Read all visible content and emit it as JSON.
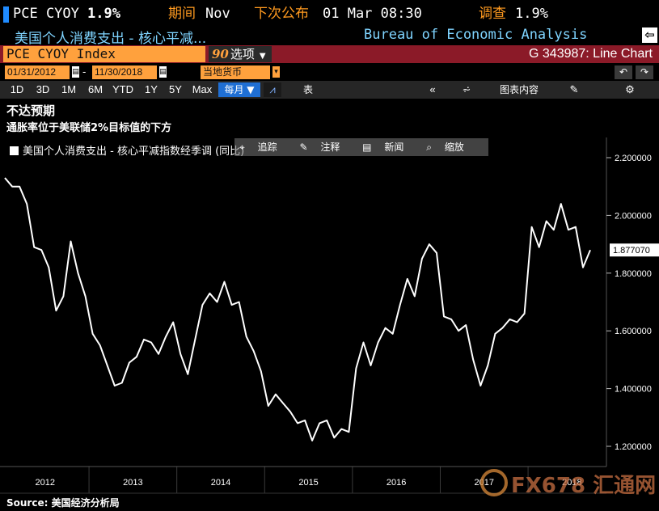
{
  "header": {
    "symbol": "PCE CYOY",
    "last_value": "1.9%",
    "period_label": "期间",
    "period_value": "Nov",
    "next_release_label": "下次公布",
    "next_release_value": "01 Mar 08:30",
    "survey_label": "调查",
    "survey_value": "1.9%",
    "description": "美国个人消费支出 - 核心平减...",
    "source": "Bureau of Economic Analysis",
    "export_icon": "export-arrow-icon"
  },
  "command_bar": {
    "ticker": "PCE CYOY Index",
    "options_number": "90",
    "options_label": "选项",
    "chart_id": "G 343987: Line Chart"
  },
  "date_bar": {
    "start_date": "01/31/2012",
    "end_date": "11/30/2018",
    "currency": "当地货币"
  },
  "range_bar": {
    "ranges": [
      "1D",
      "3D",
      "1M",
      "6M",
      "YTD",
      "1Y",
      "5Y",
      "Max"
    ],
    "frequency": "每月",
    "table_label": "表",
    "edit_label": "图表内容"
  },
  "legend_tools": {
    "track": "追踪",
    "annotate": "注释",
    "news": "新闻",
    "zoom": "缩放"
  },
  "chart_data": {
    "type": "line",
    "title": "不达预期",
    "subtitle": "通胀率位于美联储2%目标值的下方",
    "source": "Source:  美国经济分析局",
    "y_ticks": [
      "1.200000",
      "1.400000",
      "1.600000",
      "1.800000",
      "2.000000",
      "2.200000"
    ],
    "y_tick_values": [
      1.2,
      1.4,
      1.6,
      1.8,
      2.0,
      2.2
    ],
    "ylim": [
      1.13,
      2.27
    ],
    "x_ticks": [
      "2012",
      "2013",
      "2014",
      "2015",
      "2016",
      "2017",
      "2018"
    ],
    "last_value_label": "1.877070",
    "colors": {
      "line": "#ffffff",
      "background": "#000000",
      "grid": "#555555"
    },
    "series": [
      {
        "name": "美国个人消费支出 - 核心平减指数经季调 (同比)",
        "start": "2012-01",
        "values": [
          2.13,
          2.1,
          2.1,
          2.04,
          1.89,
          1.88,
          1.82,
          1.67,
          1.72,
          1.91,
          1.8,
          1.72,
          1.59,
          1.55,
          1.48,
          1.41,
          1.42,
          1.49,
          1.51,
          1.57,
          1.56,
          1.52,
          1.58,
          1.63,
          1.52,
          1.45,
          1.57,
          1.69,
          1.73,
          1.7,
          1.77,
          1.69,
          1.7,
          1.58,
          1.53,
          1.46,
          1.34,
          1.38,
          1.35,
          1.32,
          1.28,
          1.29,
          1.22,
          1.28,
          1.29,
          1.23,
          1.26,
          1.25,
          1.47,
          1.56,
          1.48,
          1.56,
          1.61,
          1.59,
          1.69,
          1.78,
          1.72,
          1.85,
          1.9,
          1.87,
          1.65,
          1.64,
          1.6,
          1.62,
          1.5,
          1.41,
          1.48,
          1.59,
          1.61,
          1.64,
          1.63,
          1.66,
          1.96,
          1.89,
          1.98,
          1.95,
          2.04,
          1.95,
          1.96,
          1.82,
          1.88
        ]
      }
    ]
  },
  "watermark": "FX678 汇通网"
}
